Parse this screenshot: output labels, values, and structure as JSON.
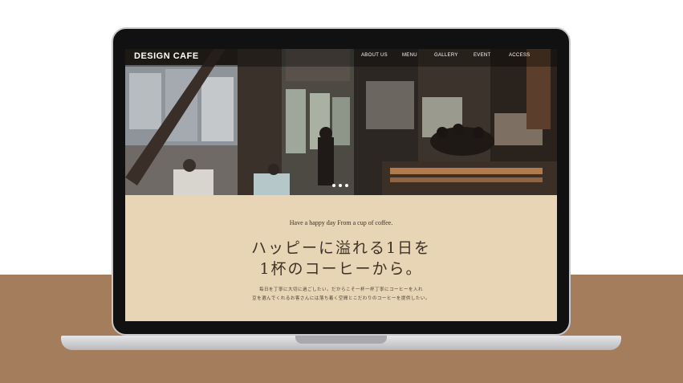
{
  "site": {
    "logo": "DESIGN CAFE",
    "nav": [
      "ABOUT US",
      "MENU",
      "GALLERY",
      "EVENT",
      "ACCESS"
    ]
  },
  "hero": {
    "slide_count": 3,
    "active_slide": 1
  },
  "content": {
    "tagline": "Have a happy day From a cup of coffee.",
    "headline_line1": "ハッピーに溢れる1日を",
    "headline_line2": "1杯のコーヒーから。",
    "body_line1": "毎日を丁寧に大切に過ごしたい。だからこそ一杯一杯丁寧にコーヒーを入れ",
    "body_line2": "豆を選んでくれるお客さんには落ち着く空間とこだわりのコーヒーを提供したい。"
  },
  "colors": {
    "background_floor": "#a37d5c",
    "screen_bg": "#e8d5b5",
    "text_dark": "#3d3128",
    "laptop_bezel": "#111111"
  }
}
